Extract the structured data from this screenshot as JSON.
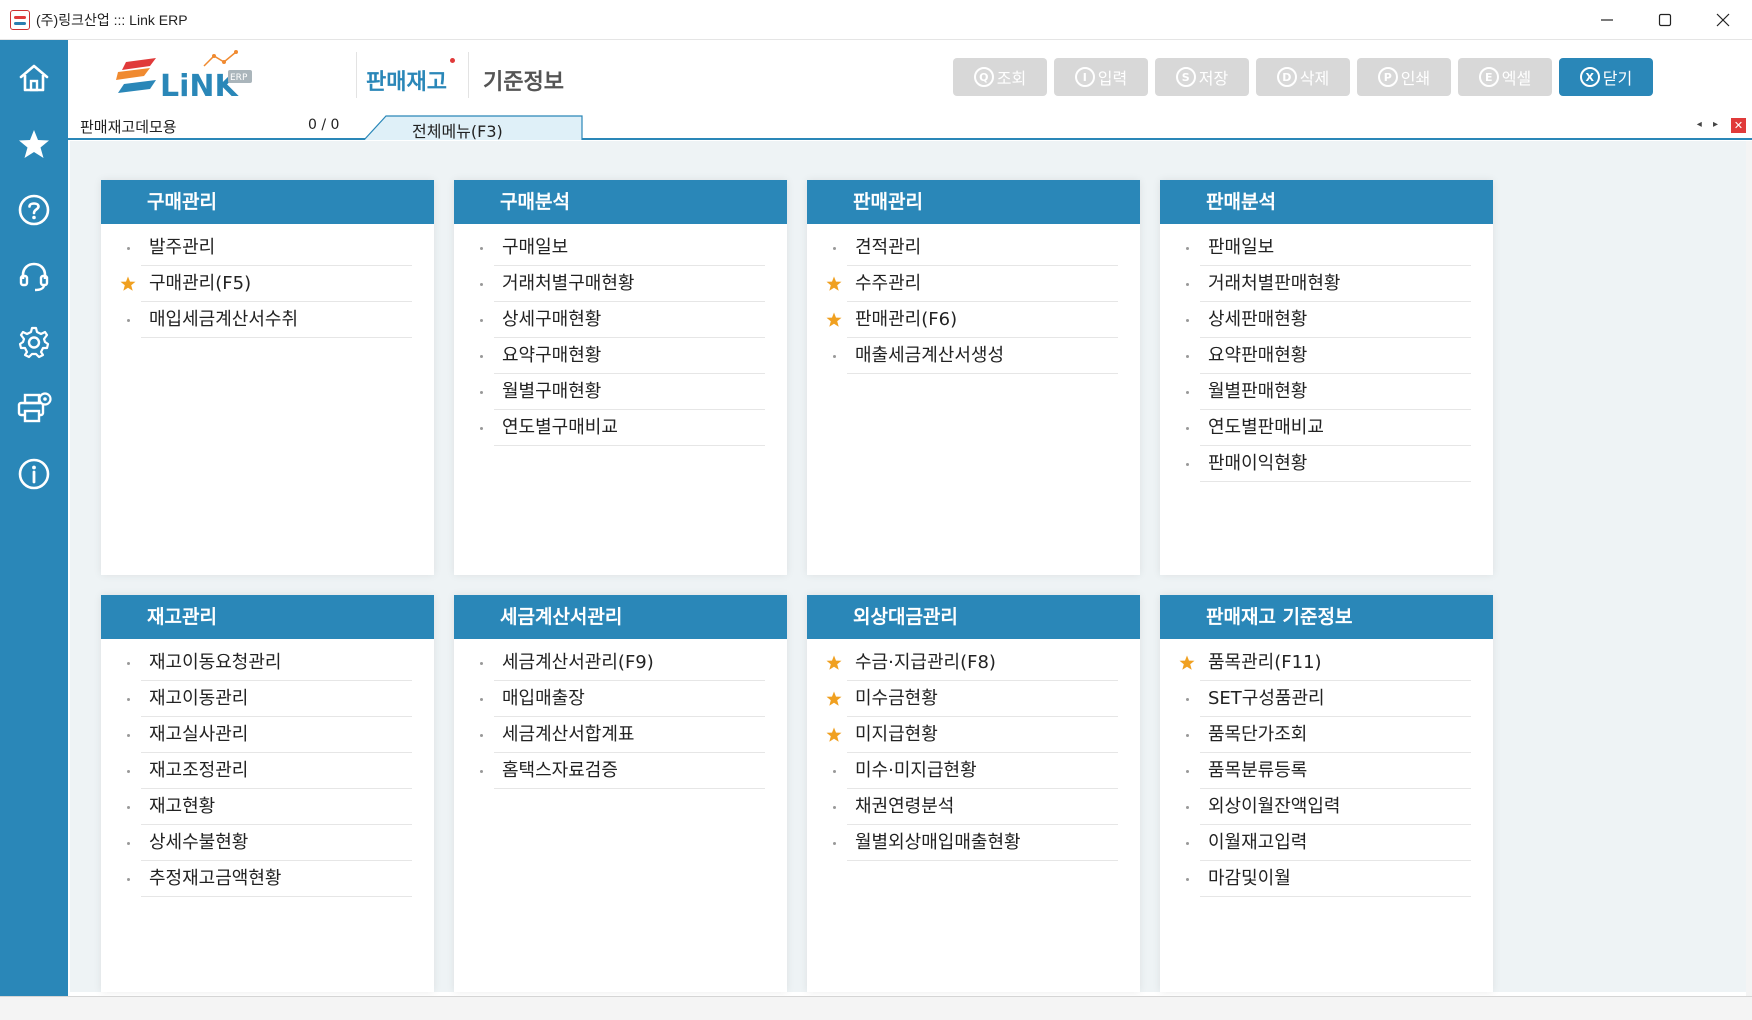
{
  "window": {
    "title": "(주)링크산업 ::: Link ERP",
    "minimize_icon": "minimize-icon",
    "maximize_icon": "maximize-icon",
    "close_icon": "close-icon"
  },
  "sidebar": {
    "items": [
      {
        "icon": "home-icon"
      },
      {
        "icon": "star-icon"
      },
      {
        "icon": "help-icon"
      },
      {
        "icon": "headset-icon"
      },
      {
        "icon": "gear-icon"
      },
      {
        "icon": "printer-settings-icon"
      },
      {
        "icon": "info-icon"
      }
    ]
  },
  "header": {
    "logo_text": "LiNK",
    "logo_badge": "ERP",
    "module_title": "판매재고",
    "module_sub": "기준정보",
    "toolbar": [
      {
        "key": "Q",
        "label": "조회",
        "enabled": false
      },
      {
        "key": "I",
        "label": "입력",
        "enabled": false
      },
      {
        "key": "S",
        "label": "저장",
        "enabled": false
      },
      {
        "key": "D",
        "label": "삭제",
        "enabled": false
      },
      {
        "key": "P",
        "label": "인쇄",
        "enabled": false
      },
      {
        "key": "E",
        "label": "엑셀",
        "enabled": false
      },
      {
        "key": "X",
        "label": "닫기",
        "enabled": true
      }
    ]
  },
  "tabstrip": {
    "company": "판매재고데모용",
    "counter": "0 / 0",
    "active_tab": "전체메뉴(F3)",
    "nav": "◂ ▸",
    "close": "✕"
  },
  "menus": [
    {
      "title": "구매관리",
      "items": [
        {
          "label": "발주관리",
          "fav": false
        },
        {
          "label": "구매관리(F5)",
          "fav": true
        },
        {
          "label": "매입세금계산서수취",
          "fav": false
        }
      ]
    },
    {
      "title": "구매분석",
      "items": [
        {
          "label": "구매일보",
          "fav": false
        },
        {
          "label": "거래처별구매현황",
          "fav": false
        },
        {
          "label": "상세구매현황",
          "fav": false
        },
        {
          "label": "요약구매현황",
          "fav": false
        },
        {
          "label": "월별구매현황",
          "fav": false
        },
        {
          "label": "연도별구매비교",
          "fav": false
        }
      ]
    },
    {
      "title": "판매관리",
      "items": [
        {
          "label": "견적관리",
          "fav": false
        },
        {
          "label": "수주관리",
          "fav": true
        },
        {
          "label": "판매관리(F6)",
          "fav": true
        },
        {
          "label": "매출세금계산서생성",
          "fav": false
        }
      ]
    },
    {
      "title": "판매분석",
      "items": [
        {
          "label": "판매일보",
          "fav": false
        },
        {
          "label": "거래처별판매현황",
          "fav": false
        },
        {
          "label": "상세판매현황",
          "fav": false
        },
        {
          "label": "요약판매현황",
          "fav": false
        },
        {
          "label": "월별판매현황",
          "fav": false
        },
        {
          "label": "연도별판매비교",
          "fav": false
        },
        {
          "label": "판매이익현황",
          "fav": false
        }
      ]
    },
    {
      "title": "재고관리",
      "items": [
        {
          "label": "재고이동요청관리",
          "fav": false
        },
        {
          "label": "재고이동관리",
          "fav": false
        },
        {
          "label": "재고실사관리",
          "fav": false
        },
        {
          "label": "재고조정관리",
          "fav": false
        },
        {
          "label": "재고현황",
          "fav": false
        },
        {
          "label": "상세수불현황",
          "fav": false
        },
        {
          "label": "추정재고금액현황",
          "fav": false
        }
      ]
    },
    {
      "title": "세금계산서관리",
      "items": [
        {
          "label": "세금계산서관리(F9)",
          "fav": false
        },
        {
          "label": "매입매출장",
          "fav": false
        },
        {
          "label": "세금계산서합계표",
          "fav": false
        },
        {
          "label": "홈택스자료검증",
          "fav": false
        }
      ]
    },
    {
      "title": "외상대금관리",
      "items": [
        {
          "label": "수금·지급관리(F8)",
          "fav": true
        },
        {
          "label": "미수금현황",
          "fav": true
        },
        {
          "label": "미지급현황",
          "fav": true
        },
        {
          "label": "미수·미지급현황",
          "fav": false
        },
        {
          "label": "채권연령분석",
          "fav": false
        },
        {
          "label": "월별외상매입매출현황",
          "fav": false
        }
      ]
    },
    {
      "title": "판매재고 기준정보",
      "items": [
        {
          "label": "품목관리(F11)",
          "fav": true
        },
        {
          "label": "SET구성품관리",
          "fav": false
        },
        {
          "label": "품목단가조회",
          "fav": false
        },
        {
          "label": "품목분류등록",
          "fav": false
        },
        {
          "label": "외상이월잔액입력",
          "fav": false
        },
        {
          "label": "이월재고입력",
          "fav": false
        },
        {
          "label": "마감및이월",
          "fav": false
        }
      ]
    }
  ],
  "colors": {
    "primary": "#2a87b8",
    "star": "#f0a020",
    "danger": "#e03a3a",
    "disabled_button": "#d8d8d8"
  }
}
